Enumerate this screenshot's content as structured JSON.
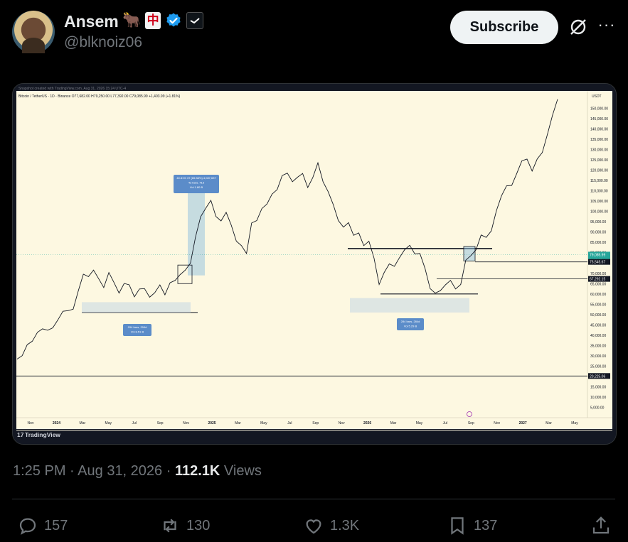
{
  "author": {
    "name": "Ansem",
    "handle": "@blknoiz06",
    "badges": [
      "ox-emoji",
      "mahjong-red-dragon-icon",
      "verified-icon",
      "affiliate-icon"
    ],
    "badge_zhong": "中",
    "badge_ox": "🐂"
  },
  "header": {
    "subscribe_label": "Subscribe",
    "more_label": "···"
  },
  "post": {
    "time": "1:25 PM",
    "date": "Aug 31, 2026",
    "views_count": "112.1K",
    "views_label": "Views"
  },
  "actions": {
    "replies": "157",
    "reposts": "130",
    "likes": "1.3K",
    "bookmarks": "137"
  },
  "chart_header": {
    "snapshot_note": "Snapshot created with TradingView.com, Aug 31, 2026 15:24 UTC-4",
    "symbol_line": "Bitcoin / TetherUS · 1D · Binance  O77,682.00  H79,250.00  L77,392.00  C79,085.99  +1,403.99 (+1.81%)",
    "brand": "TradingView"
  },
  "chart_data": {
    "type": "line",
    "ylabel": "USDT",
    "ylim": [
      0,
      155000
    ],
    "y_ticks": [
      "150,000.00",
      "145,000.00",
      "140,000.00",
      "135,000.00",
      "130,000.00",
      "125,000.00",
      "120,000.00",
      "115,000.00",
      "110,000.00",
      "105,000.00",
      "100,000.00",
      "95,000.00",
      "90,000.00",
      "85,000.00",
      "80,000.00",
      "75,000.00",
      "70,000.00",
      "65,000.00",
      "60,000.00",
      "55,000.00",
      "50,000.00",
      "45,000.00",
      "40,000.00",
      "35,000.00",
      "30,000.00",
      "25,000.00",
      "20,000.00",
      "15,000.00",
      "10,000.00",
      "5,000.00"
    ],
    "x_ticks": [
      "Nov",
      "2024",
      "Mar",
      "May",
      "Jul",
      "Sep",
      "Nov",
      "2025",
      "Mar",
      "May",
      "Jul",
      "Sep",
      "Nov",
      "2026",
      "Mar",
      "May",
      "Jul",
      "Sep",
      "Nov",
      "2027",
      "Mar",
      "May"
    ],
    "price_labels": [
      {
        "text": "79,085.99",
        "sub": "04:35:32",
        "value": 79086,
        "color": "#26a69a"
      },
      {
        "text": "75,545.67",
        "value": 75546,
        "color": "#ffffff"
      },
      {
        "text": "67,292.15",
        "value": 67292,
        "color": "#ffffff"
      },
      {
        "text": "20,225.06",
        "value": 20225,
        "color": "#ffffff"
      }
    ],
    "annotations": [
      {
        "lines": [
          "40.81% 37 (65.58%) 4,087,637",
          "42 bars, 41d",
          "Vol 1.80 B"
        ]
      },
      {
        "lines": [
          "294 bars, 294d",
          "Vol 8.51 B"
        ]
      },
      {
        "lines": [
          "284 bars, 284d",
          "Vol 5.29 B"
        ]
      }
    ],
    "series": [
      {
        "values": [
          28000,
          30500,
          35000,
          37500,
          41000,
          43500,
          42000,
          44000,
          47000,
          52000,
          51500,
          53000,
          61000,
          70000,
          68000,
          72000,
          67000,
          63500,
          70000,
          66000,
          60000,
          65500,
          64000,
          59000,
          62000,
          63000,
          58000,
          61000,
          64000,
          60000,
          65000,
          67000,
          69000,
          72000,
          74500,
          88000,
          97000,
          102000,
          105000,
          98000,
          95000,
          100000,
          93000,
          86000,
          83000,
          80000,
          94000,
          96000,
          101000,
          104000,
          108000,
          111000,
          117000,
          119000,
          114000,
          117000,
          118000,
          112000,
          116000,
          124000,
          114000,
          110000,
          103000,
          96000,
          92000,
          95000,
          88000,
          90000,
          83000,
          86000,
          77000,
          65000,
          70000,
          75000,
          73000,
          78000,
          81000,
          84000,
          79000,
          80000,
          72000,
          63000,
          60000,
          62000,
          64000,
          67000,
          62000,
          65000,
          76000,
          79000,
          81000,
          89000,
          87000,
          91000,
          100000,
          108000,
          112000,
          113000,
          118000,
          125000,
          125000,
          120000,
          125000,
          129000,
          137000,
          147000,
          154000
        ]
      }
    ]
  }
}
